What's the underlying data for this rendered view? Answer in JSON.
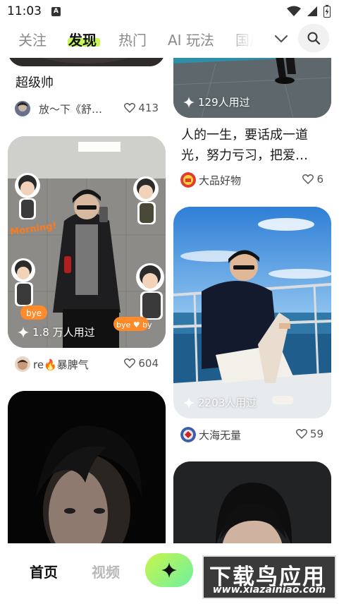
{
  "status_bar": {
    "time": "11:03",
    "notification_icon": "A"
  },
  "tabs": [
    {
      "label": "关注"
    },
    {
      "label": "发现"
    },
    {
      "label": "热门"
    },
    {
      "label": "AI 玩法"
    },
    {
      "label": "国风"
    }
  ],
  "active_tab": "发现",
  "feed": {
    "left": [
      {
        "title": "超级帅",
        "author": "放～下《舒…",
        "likes": "413"
      },
      {
        "badge": "1.8 万人用过",
        "author": "re🔥暴脾气",
        "likes": "604"
      },
      {
        "badge": ""
      }
    ],
    "right": [
      {
        "badge": "129人用过",
        "title_line1": "人的一生，要话成一道",
        "title_line2": "光，努力亏习，把爱…",
        "author": "大品好物",
        "likes": "6"
      },
      {
        "badge": "2203人用过",
        "author": "大海无量",
        "likes": "59"
      },
      {
        "badge": ""
      }
    ]
  },
  "bottom_nav": {
    "home": "首页",
    "video": "视频"
  },
  "watermark": {
    "main": "下载鸟应用",
    "sub": "www.xiazainiao.com"
  },
  "colors": {
    "accent": "#c8f55a",
    "text": "#1a1a1a",
    "muted": "#8a8a8a"
  }
}
